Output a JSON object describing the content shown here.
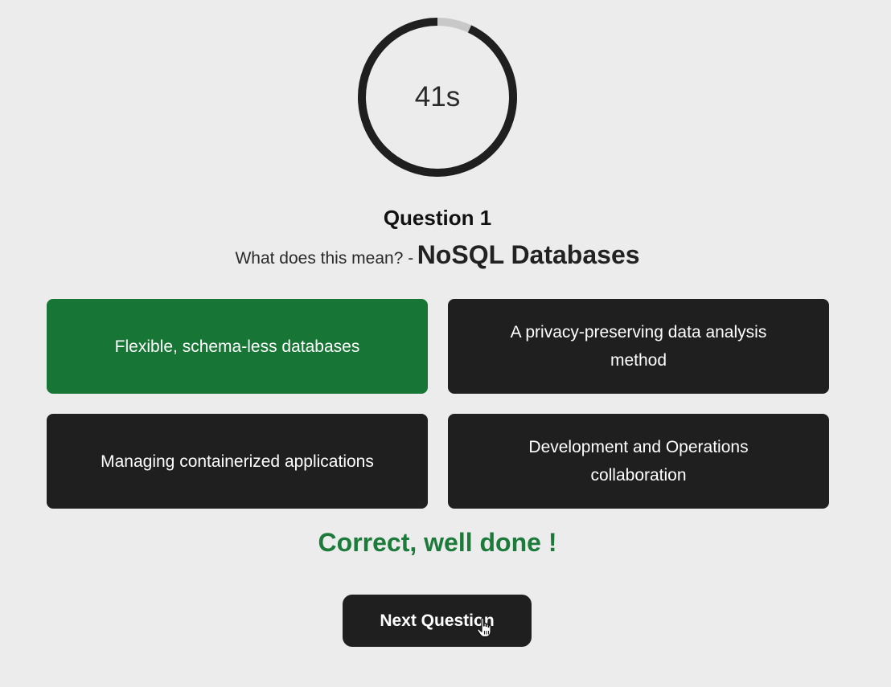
{
  "timer": {
    "text": "41s",
    "remaining_fraction": 0.93,
    "ring_color": "#1f1f1f",
    "track_color": "#c8c8c8"
  },
  "question": {
    "number_label": "Question 1",
    "prompt": "What does this mean? -",
    "term": "NoSQL Databases"
  },
  "answers": [
    {
      "label": "Flexible, schema-less databases",
      "state": "correct"
    },
    {
      "label": "A privacy-preserving data analysis method",
      "state": "default"
    },
    {
      "label": "Managing containerized applications",
      "state": "default"
    },
    {
      "label": "Development and Operations collaboration",
      "state": "default"
    }
  ],
  "feedback": {
    "text": "Correct, well done !",
    "color": "#1c7a3a"
  },
  "next_button": {
    "label": "Next Question"
  },
  "colors": {
    "background": "#ececec",
    "answer_default": "#1f1f1f",
    "answer_correct": "#177535"
  }
}
